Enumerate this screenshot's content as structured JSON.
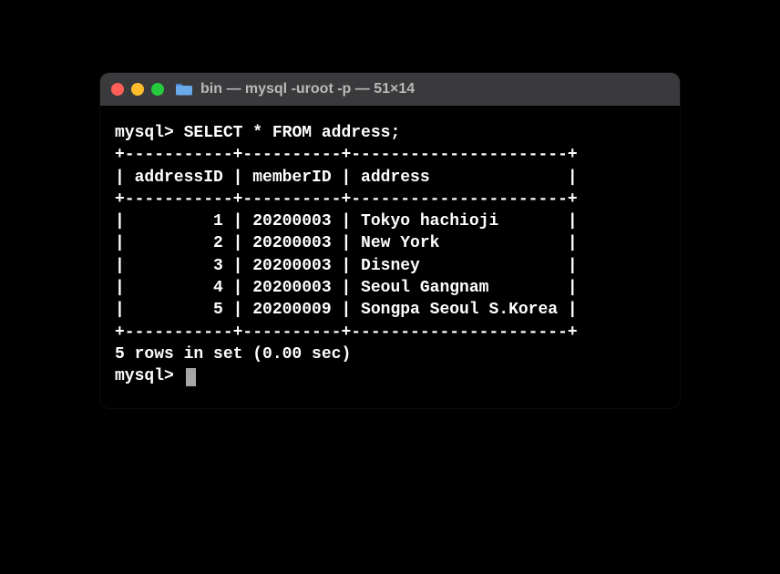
{
  "window": {
    "title": "bin — mysql -uroot -p — 51×14"
  },
  "terminal": {
    "prompt1_prefix": "mysql> ",
    "query": "SELECT * FROM address;",
    "border_top": "+-----------+----------+----------------------+",
    "header_row": "| addressID | memberID | address              |",
    "border_mid": "+-----------+----------+----------------------+",
    "row1": "|         1 | 20200003 | Tokyo hachioji       |",
    "row2": "|         2 | 20200003 | New York             |",
    "row3": "|         3 | 20200003 | Disney               |",
    "row4": "|         4 | 20200003 | Seoul Gangnam        |",
    "row5": "|         5 | 20200009 | Songpa Seoul S.Korea |",
    "border_bot": "+-----------+----------+----------------------+",
    "status": "5 rows in set (0.00 sec)",
    "blank": "",
    "prompt2": "mysql> "
  },
  "chart_data": {
    "type": "table",
    "title": "address",
    "columns": [
      "addressID",
      "memberID",
      "address"
    ],
    "rows": [
      [
        1,
        "20200003",
        "Tokyo hachioji"
      ],
      [
        2,
        "20200003",
        "New York"
      ],
      [
        3,
        "20200003",
        "Disney"
      ],
      [
        4,
        "20200003",
        "Seoul Gangnam"
      ],
      [
        5,
        "20200009",
        "Songpa Seoul S.Korea"
      ]
    ],
    "row_count": 5,
    "elapsed_sec": 0.0
  }
}
